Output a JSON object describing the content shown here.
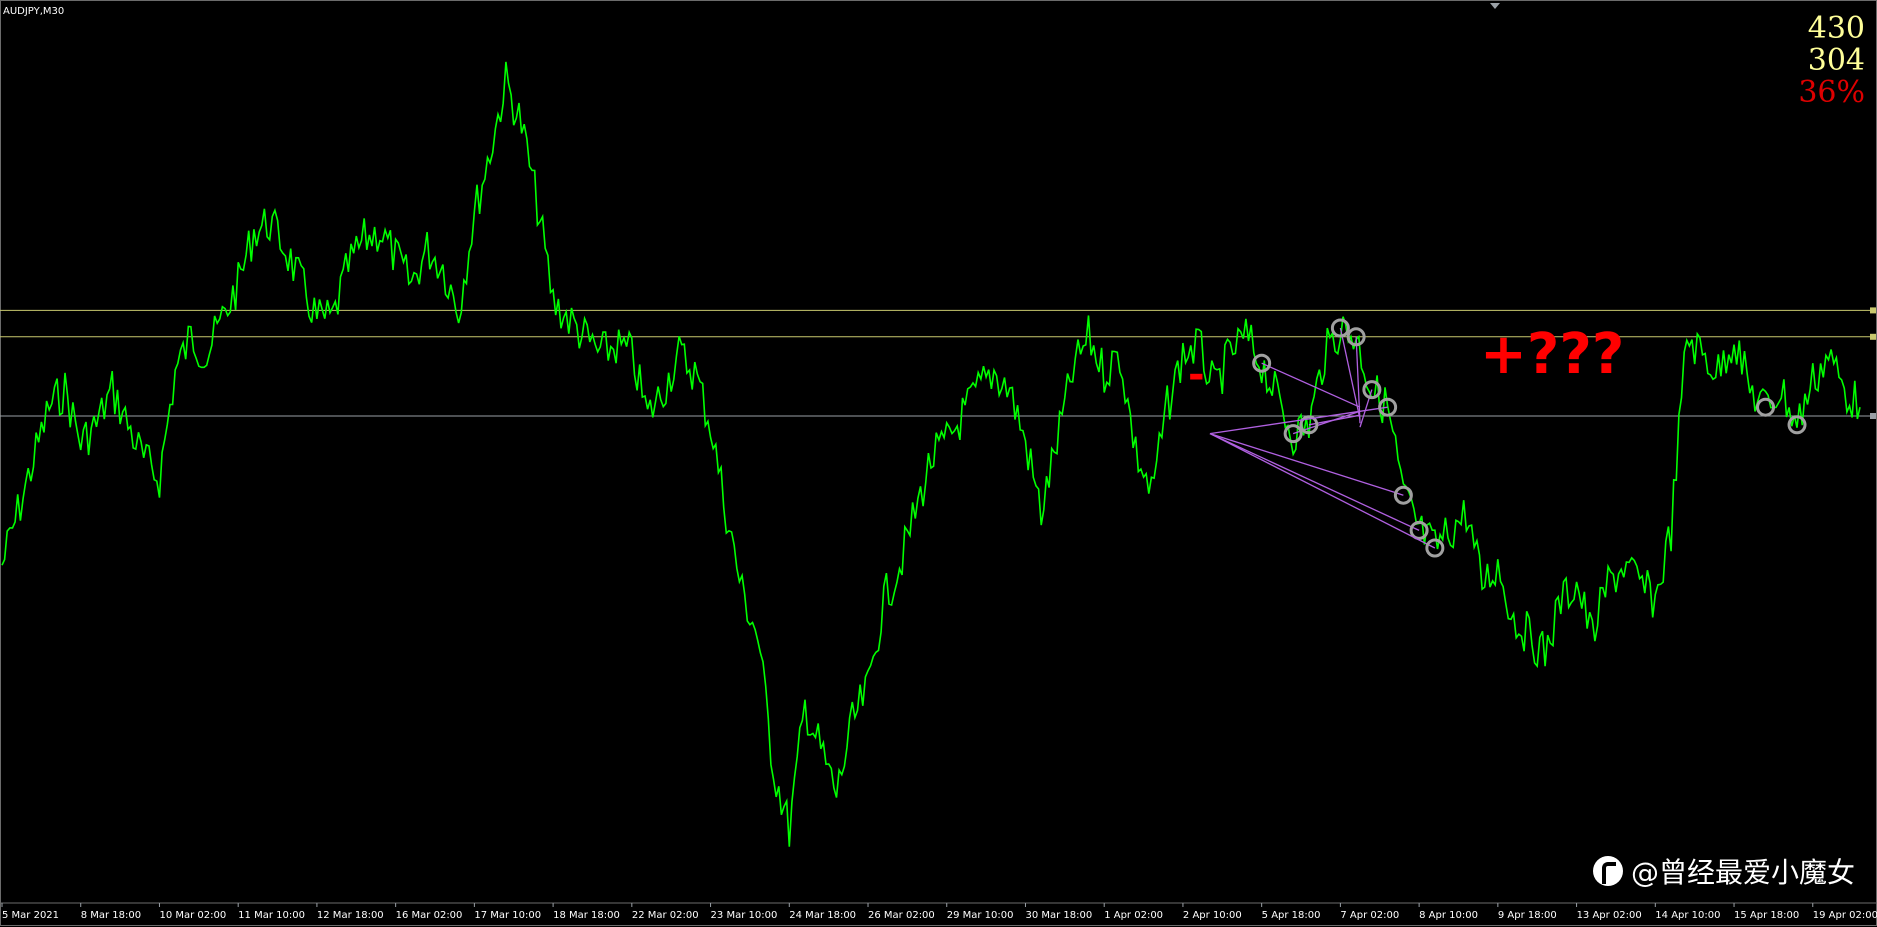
{
  "window": {
    "symbol_title": "AUDJPY,M30"
  },
  "stats": {
    "values": [
      {
        "text": "430",
        "color": "#ffff99"
      },
      {
        "text": "304",
        "color": "#ffff99"
      },
      {
        "text": "36%",
        "color": "#dd0000"
      }
    ]
  },
  "annotations": {
    "minus": "-",
    "plus": "+???"
  },
  "watermark": {
    "icon": "toutiao-logo-icon",
    "text": "@曾经最爱小魔女"
  },
  "chart_data": {
    "type": "line",
    "title": "",
    "xlabel": "",
    "ylabel": "",
    "series": [
      {
        "color": "#00ff00",
        "values": [
          0.62,
          0.56,
          0.5,
          0.44,
          0.42,
          0.48,
          0.46,
          0.42,
          0.46,
          0.5,
          0.52,
          0.4,
          0.36,
          0.38,
          0.34,
          0.3,
          0.24,
          0.23,
          0.26,
          0.3,
          0.34,
          0.34,
          0.28,
          0.25,
          0.24,
          0.27,
          0.3,
          0.26,
          0.28,
          0.33,
          0.22,
          0.15,
          0.07,
          0.12,
          0.21,
          0.32,
          0.34,
          0.36,
          0.38,
          0.37,
          0.38,
          0.45,
          0.42,
          0.38,
          0.4,
          0.46,
          0.56,
          0.65,
          0.7,
          0.85,
          0.92,
          0.78,
          0.83,
          0.88,
          0.8,
          0.76,
          0.66,
          0.62,
          0.56,
          0.5,
          0.48,
          0.45,
          0.42,
          0.4,
          0.42,
          0.48,
          0.56,
          0.48,
          0.4,
          0.36,
          0.4,
          0.38,
          0.49,
          0.54,
          0.44,
          0.38,
          0.37,
          0.42,
          0.38,
          0.36,
          0.39,
          0.43,
          0.47,
          0.46,
          0.38,
          0.35,
          0.36,
          0.42,
          0.44,
          0.54,
          0.58,
          0.6,
          0.58,
          0.56,
          0.64,
          0.62,
          0.68,
          0.7,
          0.72,
          0.66,
          0.64,
          0.7,
          0.64,
          0.62,
          0.64,
          0.66,
          0.58,
          0.36,
          0.38,
          0.4,
          0.36,
          0.42,
          0.44,
          0.42,
          0.46,
          0.41,
          0.38,
          0.42,
          0.44
        ]
      }
    ],
    "levels": [
      {
        "value": 0.33,
        "color": "#c8c86e"
      },
      {
        "value": 0.36,
        "color": "#c8c86e"
      },
      {
        "value": 0.45,
        "color": "#9aa0a6"
      }
    ],
    "categories": [
      "5 Mar 2021",
      "8 Mar 18:00",
      "10 Mar 02:00",
      "11 Mar 10:00",
      "12 Mar 18:00",
      "16 Mar 02:00",
      "17 Mar 10:00",
      "18 Mar 18:00",
      "22 Mar 02:00",
      "23 Mar 10:00",
      "24 Mar 18:00",
      "26 Mar 02:00",
      "29 Mar 10:00",
      "30 Mar 18:00",
      "1 Apr 02:00",
      "2 Apr 10:00",
      "5 Apr 18:00",
      "7 Apr 02:00",
      "8 Apr 10:00",
      "9 Apr 18:00",
      "13 Apr 02:00",
      "14 Apr 10:00",
      "15 Apr 18:00",
      "19 Apr 02:00"
    ],
    "category_positions": [
      0,
      5,
      10,
      15,
      20,
      25,
      30,
      35,
      40,
      45,
      50,
      55,
      60,
      65,
      70,
      75,
      80,
      85,
      90,
      95,
      100,
      105,
      110,
      115
    ]
  }
}
